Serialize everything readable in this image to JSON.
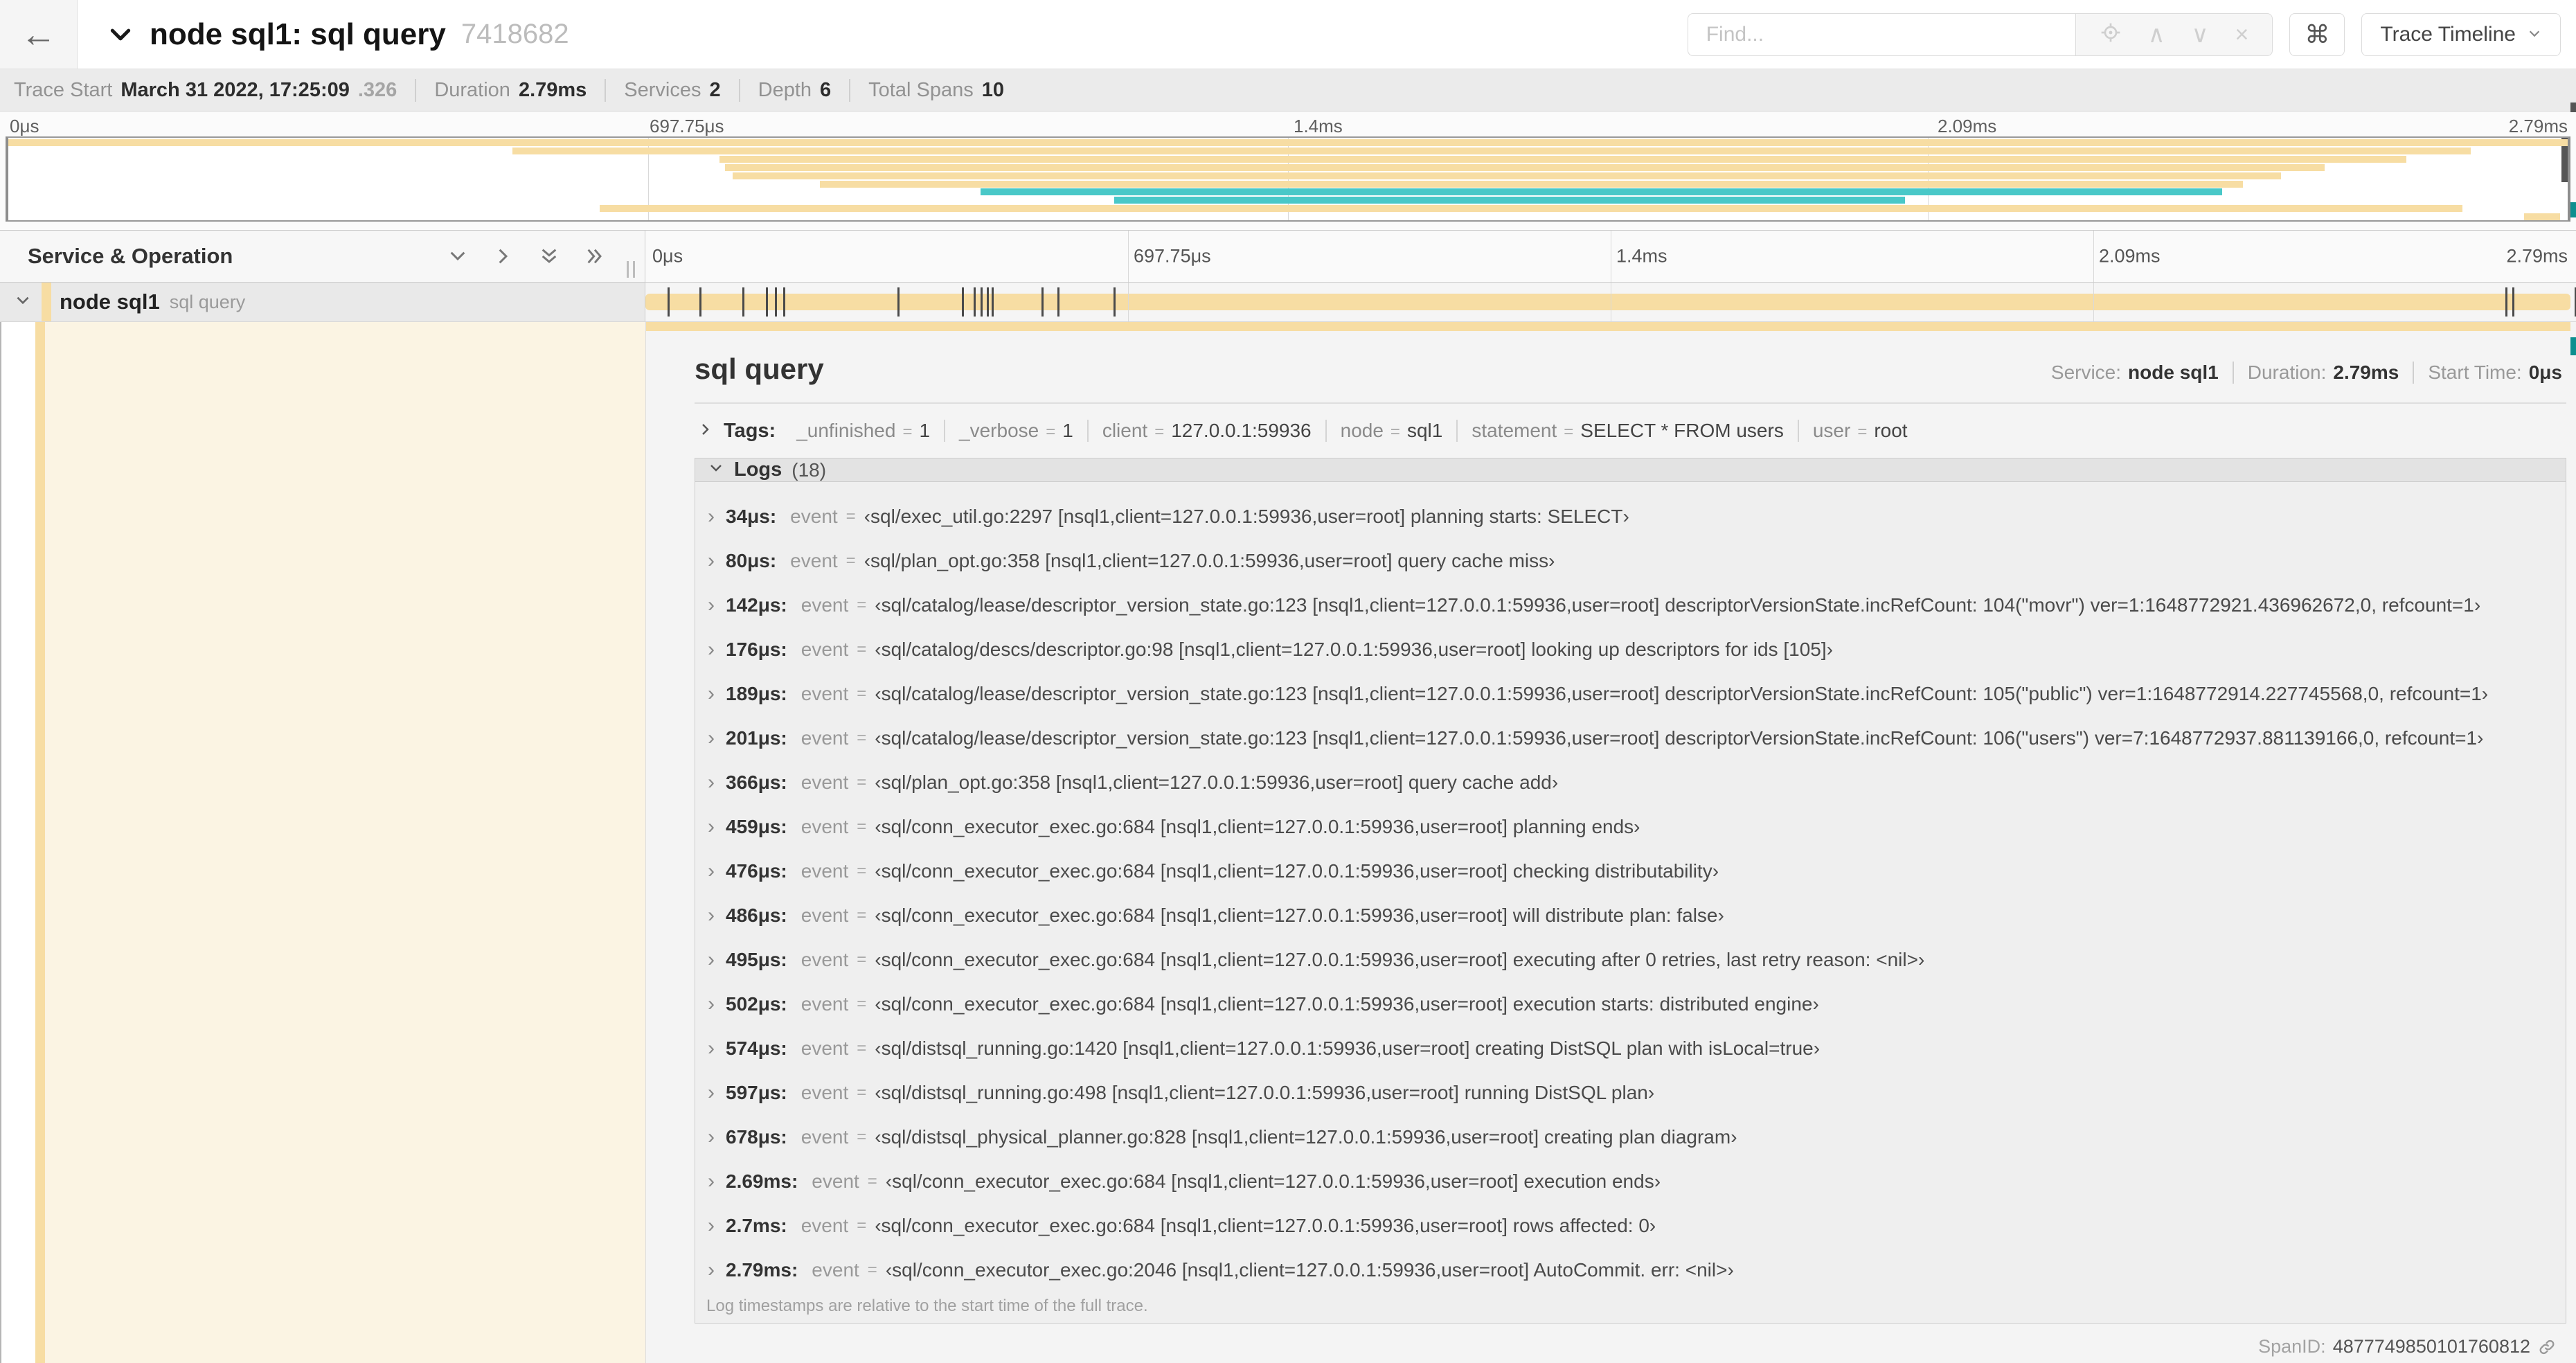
{
  "header": {
    "back_icon": "←",
    "title": "node sql1: sql query",
    "trace_id": "7418682",
    "find_placeholder": "Find...",
    "prev_icon": "∧",
    "next_icon": "∨",
    "clear_icon": "×",
    "shortcut_icon": "⌘",
    "view_button": "Trace Timeline"
  },
  "stats": [
    {
      "label": "Trace Start",
      "value": "March 31 2022, 17:25:09",
      "suffix": ".326"
    },
    {
      "label": "Duration",
      "value": "2.79ms"
    },
    {
      "label": "Services",
      "value": "2"
    },
    {
      "label": "Depth",
      "value": "6"
    },
    {
      "label": "Total Spans",
      "value": "10"
    }
  ],
  "timeline": {
    "header_label": "Service & Operation",
    "ticks": [
      "0μs",
      "697.75μs",
      "1.4ms",
      "2.09ms",
      "2.79ms"
    ],
    "total_us": 2790
  },
  "minimap": {
    "spans": [
      {
        "color": "span_tan",
        "start": 0,
        "end": 100
      },
      {
        "color": "span_tan",
        "start": 19.7,
        "end": 96.2
      },
      {
        "color": "span_tan",
        "start": 27.8,
        "end": 93.7
      },
      {
        "color": "span_tan",
        "start": 28.0,
        "end": 90.5
      },
      {
        "color": "span_tan",
        "start": 28.3,
        "end": 88.8
      },
      {
        "color": "span_tan",
        "start": 31.7,
        "end": 87.3
      },
      {
        "color": "span_teal",
        "start": 38.0,
        "end": 86.5
      },
      {
        "color": "span_teal",
        "start": 43.2,
        "end": 74.1
      },
      {
        "color": "span_tan",
        "start": 23.1,
        "end": 95.9
      },
      {
        "color": "span_tan",
        "start": 98.3,
        "end": 99.7
      }
    ]
  },
  "span_row": {
    "service": "node sql1",
    "operation": "sql query"
  },
  "detail": {
    "title": "sql query",
    "meta": [
      {
        "label": "Service:",
        "value": "node sql1"
      },
      {
        "label": "Duration:",
        "value": "2.79ms"
      },
      {
        "label": "Start Time:",
        "value": "0μs"
      }
    ],
    "tags_label": "Tags:",
    "eq": "=",
    "tags": [
      {
        "key": "_unfinished",
        "value": "1"
      },
      {
        "key": "_verbose",
        "value": "1"
      },
      {
        "key": "client",
        "value": "127.0.0.1:59936"
      },
      {
        "key": "node",
        "value": "sql1"
      },
      {
        "key": "statement",
        "value": "SELECT * FROM users"
      },
      {
        "key": "user",
        "value": "root"
      }
    ],
    "logs_label": "Logs",
    "logs_count": "(18)",
    "log_key": "event",
    "logs": [
      {
        "ts": "34μs:",
        "t_us": 34,
        "event": "‹sql/exec_util.go:2297 [nsql1,client=127.0.0.1:59936,user=root] planning starts: SELECT›"
      },
      {
        "ts": "80μs:",
        "t_us": 80,
        "event": "‹sql/plan_opt.go:358 [nsql1,client=127.0.0.1:59936,user=root] query cache miss›"
      },
      {
        "ts": "142μs:",
        "t_us": 142,
        "event": "‹sql/catalog/lease/descriptor_version_state.go:123 [nsql1,client=127.0.0.1:59936,user=root] descriptorVersionState.incRefCount: 104(\"movr\") ver=1:1648772921.436962672,0, refcount=1›"
      },
      {
        "ts": "176μs:",
        "t_us": 176,
        "event": "‹sql/catalog/descs/descriptor.go:98 [nsql1,client=127.0.0.1:59936,user=root] looking up descriptors for ids [105]›"
      },
      {
        "ts": "189μs:",
        "t_us": 189,
        "event": "‹sql/catalog/lease/descriptor_version_state.go:123 [nsql1,client=127.0.0.1:59936,user=root] descriptorVersionState.incRefCount: 105(\"public\") ver=1:1648772914.227745568,0, refcount=1›"
      },
      {
        "ts": "201μs:",
        "t_us": 201,
        "event": "‹sql/catalog/lease/descriptor_version_state.go:123 [nsql1,client=127.0.0.1:59936,user=root] descriptorVersionState.incRefCount: 106(\"users\") ver=7:1648772937.881139166,0, refcount=1›"
      },
      {
        "ts": "366μs:",
        "t_us": 366,
        "event": "‹sql/plan_opt.go:358 [nsql1,client=127.0.0.1:59936,user=root] query cache add›"
      },
      {
        "ts": "459μs:",
        "t_us": 459,
        "event": "‹sql/conn_executor_exec.go:684 [nsql1,client=127.0.0.1:59936,user=root] planning ends›"
      },
      {
        "ts": "476μs:",
        "t_us": 476,
        "event": "‹sql/conn_executor_exec.go:684 [nsql1,client=127.0.0.1:59936,user=root] checking distributability›"
      },
      {
        "ts": "486μs:",
        "t_us": 486,
        "event": "‹sql/conn_executor_exec.go:684 [nsql1,client=127.0.0.1:59936,user=root] will distribute plan: false›"
      },
      {
        "ts": "495μs:",
        "t_us": 495,
        "event": "‹sql/conn_executor_exec.go:684 [nsql1,client=127.0.0.1:59936,user=root] executing after 0 retries, last retry reason: <nil>›"
      },
      {
        "ts": "502μs:",
        "t_us": 502,
        "event": "‹sql/conn_executor_exec.go:684 [nsql1,client=127.0.0.1:59936,user=root] execution starts: distributed engine›"
      },
      {
        "ts": "574μs:",
        "t_us": 574,
        "event": "‹sql/distsql_running.go:1420 [nsql1,client=127.0.0.1:59936,user=root] creating DistSQL plan with isLocal=true›"
      },
      {
        "ts": "597μs:",
        "t_us": 597,
        "event": "‹sql/distsql_running.go:498 [nsql1,client=127.0.0.1:59936,user=root] running DistSQL plan›"
      },
      {
        "ts": "678μs:",
        "t_us": 678,
        "event": "‹sql/distsql_physical_planner.go:828 [nsql1,client=127.0.0.1:59936,user=root] creating plan diagram›"
      },
      {
        "ts": "2.69ms:",
        "t_us": 2690,
        "event": "‹sql/conn_executor_exec.go:684 [nsql1,client=127.0.0.1:59936,user=root] execution ends›"
      },
      {
        "ts": "2.7ms:",
        "t_us": 2700,
        "event": "‹sql/conn_executor_exec.go:684 [nsql1,client=127.0.0.1:59936,user=root] rows affected: 0›"
      },
      {
        "ts": "2.79ms:",
        "t_us": 2790,
        "event": "‹sql/conn_executor_exec.go:2046 [nsql1,client=127.0.0.1:59936,user=root] AutoCommit. err: <nil>›"
      }
    ],
    "logs_footer": "Log timestamps are relative to the start time of the full trace.",
    "span_id_label": "SpanID:",
    "span_id": "4877749850101760812"
  },
  "colors": {
    "span_tan": "#f7dda3",
    "span_teal": "#49c8c8",
    "edge_teal": "#0d8f8f",
    "edge_dark": "#555555",
    "accent_cream": "#fbf4e3"
  }
}
